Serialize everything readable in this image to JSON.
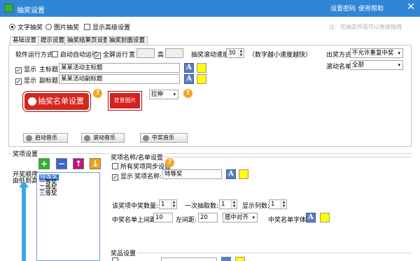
{
  "window": {
    "title": "抽奖设置",
    "menu": [
      "设置密码",
      "使用帮助"
    ],
    "close": "✕"
  },
  "top_options": {
    "radio_text": "文字抽奖",
    "radio_image": "图片抽奖",
    "show_advanced": "显示高级设置",
    "hint": "注：在抽奖界面可以直接拖拽"
  },
  "tabs": [
    "基础设置",
    "提示设置",
    "抽奖结果页设置",
    "抽奖封面设置"
  ],
  "basic": {
    "run_mode_label": "软件运行方式",
    "auto_run": "启动自动运行",
    "fullscreen": "全屏运行",
    "width_label": "宽",
    "height_label": "高",
    "speed_label": "抽奖滚动速度",
    "speed_value": "30",
    "speed_note": "（数字越小速度越快）",
    "show_label": "显示",
    "main_title_label": "主标题",
    "main_title_value": "某某活动主标题",
    "sub_title_label": "副标题",
    "sub_title_value": "某某活动副标题",
    "font_btn": "A",
    "out_mode_label": "出奖方式",
    "out_mode_value": "不允许重复中奖",
    "scroll_list_label": "滚动名单",
    "scroll_list_value": "全部",
    "list_button": "抽奖名单设置",
    "bg_button": "背景图片",
    "stretch_value": "拉伸",
    "start_music": "启动音乐",
    "scroll_music": "滚动音乐",
    "win_music": "中奖音乐"
  },
  "prizes": {
    "section_title": "奖项设置",
    "order_text": [
      "开奖顺序",
      "由低到高"
    ],
    "toolbar": [
      "+",
      "−",
      "↑",
      "↓"
    ],
    "colors": [
      "#2db52d",
      "#3a66d4",
      "#c0137a",
      "#f2a01c"
    ],
    "list": [
      "特等奖",
      "一等奖",
      "二等奖",
      "三等奖"
    ]
  },
  "prize_detail": {
    "section_title": "奖项名称/名单设置",
    "sync_all": "所有奖项同步设置",
    "show_label": "显示",
    "name_label": "奖项名称:",
    "name_value": "特等奖",
    "count_label": "该奖项中奖数量:",
    "count_value": "1",
    "draw_once_label": "一次抽取数:",
    "draw_once_value": "1",
    "columns_label": "显示列数:",
    "columns_value": "1",
    "top_margin_label": "中奖名单上间距:",
    "top_margin_value": "10",
    "left_margin_label": "左间距:",
    "left_margin_value": "20",
    "align_value": "居中对齐",
    "font_label": "中奖名单字体",
    "prize_settings_title": "奖品设置"
  }
}
